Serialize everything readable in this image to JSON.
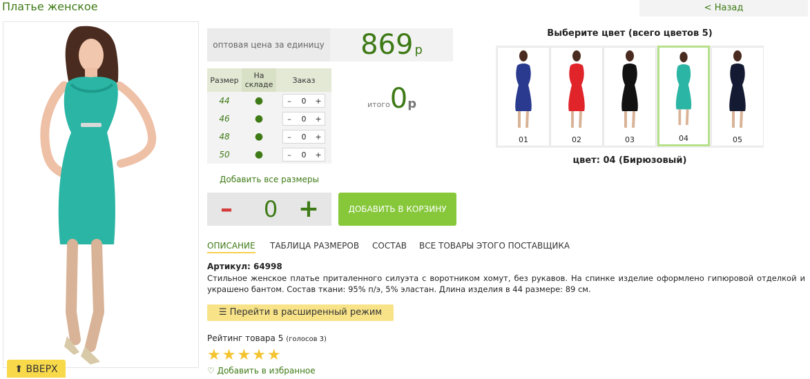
{
  "page": {
    "title": "Платье женское",
    "back_label": "< Назад",
    "up_label": "⬆ ВВЕРХ"
  },
  "colors": {
    "teal": "#2bb5a5",
    "green": "#3e7a16",
    "button_green": "#86c83a",
    "yellow": "#f8d94a",
    "red": "#d43c3c"
  },
  "price": {
    "label": "оптовая цена за единицу",
    "value": "869",
    "currency": "р"
  },
  "size_table": {
    "headers": [
      "Размер",
      "На складе",
      "Заказ"
    ],
    "rows": [
      {
        "size": "44",
        "stock": "●",
        "qty": "0"
      },
      {
        "size": "46",
        "stock": "●",
        "qty": "0"
      },
      {
        "size": "48",
        "stock": "●",
        "qty": "0"
      },
      {
        "size": "50",
        "stock": "●",
        "qty": "0"
      }
    ],
    "minus": "–",
    "plus": "+"
  },
  "total": {
    "label": "итого",
    "value": "0",
    "currency": "р"
  },
  "add_all_label": "Добавить все размеры",
  "quantity": {
    "minus": "–",
    "value": "0",
    "plus": "+"
  },
  "cart_button": "ДОБАВИТЬ В КОРЗИНУ",
  "tabs": [
    "ОПИСАНИЕ",
    "ТАБЛИЦА РАЗМЕРОВ",
    "СОСТАВ",
    "ВСЕ ТОВАРЫ ЭТОГО ПОСТАВЩИКА"
  ],
  "article": "Артикул: 64998",
  "description": "Стильное женское платье приталенного силуэта с воротником хомут, без рукавов. На спинке изделие оформлено гипюровой отделкой и украшено бантом. Состав ткани: 95% п/э, 5% эластан. Длина изделия в 44 размере: 89 см.",
  "advanced_button": "☰ Перейти в расширенный режим",
  "rating": {
    "label": "Рейтинг товара 5",
    "votes": "(голосов 3)",
    "stars": "★★★★★"
  },
  "favorites": "♡ Добавить в избранное",
  "color_picker": {
    "title": "Выберите цвет (всего цветов 5)",
    "swatches": [
      {
        "num": "01",
        "color": "#2a3a8f"
      },
      {
        "num": "02",
        "color": "#e0242a"
      },
      {
        "num": "03",
        "color": "#111111"
      },
      {
        "num": "04",
        "color": "#2bb5a5"
      },
      {
        "num": "05",
        "color": "#151a33"
      }
    ],
    "current": "цвет: 04 (Бирюзовый)"
  }
}
